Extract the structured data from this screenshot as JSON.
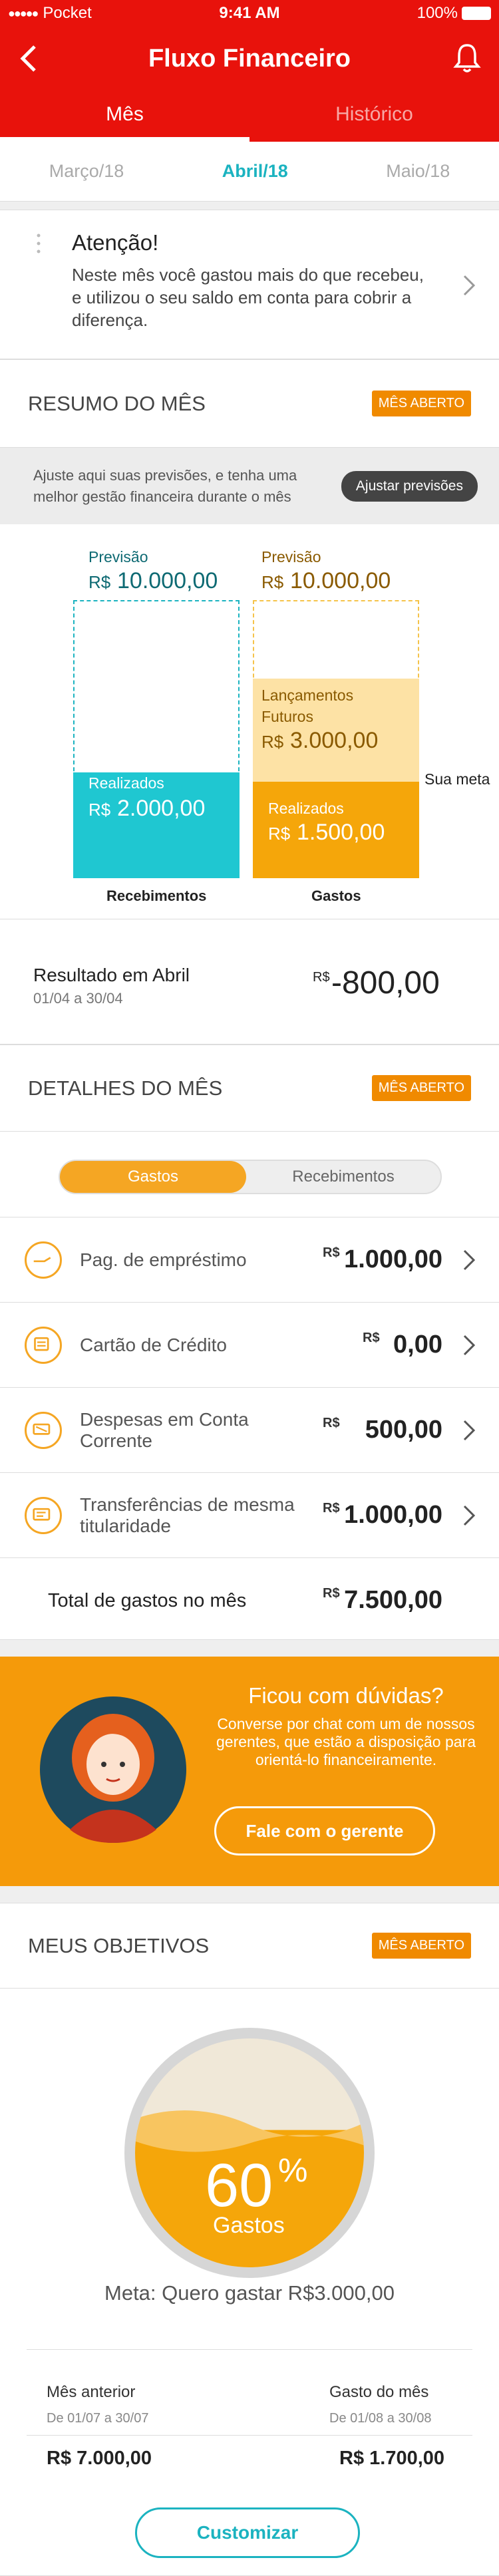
{
  "status_bar": {
    "carrier": "Pocket",
    "time": "9:41 AM",
    "battery": "100%"
  },
  "header": {
    "title": "Fluxo Financeiro"
  },
  "tabs": [
    {
      "label": "Mês"
    },
    {
      "label": "Histórico"
    }
  ],
  "months": {
    "prev": "Março/18",
    "current": "Abril/18",
    "next": "Maio/18"
  },
  "alert": {
    "title": "Atenção!",
    "text": "Neste mês você gastou mais do que recebeu, e utilizou o seu saldo em conta para cobrir a diferença."
  },
  "resumo": {
    "title": "RESUMO DO MÊS",
    "badge": "MÊS ABERTO",
    "adjust_text": "Ajuste aqui suas previsões, e tenha uma melhor gestão financeira durante o mês",
    "adjust_button": "Ajustar previsões",
    "receb": {
      "prev_label": "Previsão",
      "prev_cur": "R$",
      "prev_value": "10.000,00",
      "real_label": "Realizados",
      "real_cur": "R$",
      "real_value": "2.000,00",
      "caption": "Recebimentos",
      "fill": 0.2
    },
    "gastos": {
      "prev_label": "Previsão",
      "prev_cur": "R$",
      "prev_value": "10.000,00",
      "lanc_label": "Lançamentos",
      "lanc_label2": "Futuros",
      "lanc_cur": "R$",
      "lanc_value": "3.000,00",
      "real_label": "Realizados",
      "real_cur": "R$",
      "real_value": "1.500,00",
      "caption": "Gastos",
      "meta": "Sua meta"
    },
    "result_label": "Resultado em Abril",
    "result_period": "01/04 a 30/04",
    "result_cur": "R$",
    "result_value": "-800,00"
  },
  "details": {
    "title": "DETALHES DO MÊS",
    "badge": "MÊS ABERTO",
    "toggle_on": "Gastos",
    "toggle_off": "Recebimentos",
    "rows": [
      {
        "name": "Pag. de empréstimo",
        "cur": "R$",
        "value": "1.000,00"
      },
      {
        "name": "Cartão de Crédito",
        "cur": "R$",
        "value": "0,00"
      },
      {
        "name": "Despesas em Conta Corrente",
        "cur": "R$",
        "value": "500,00"
      },
      {
        "name": "Transferências de mesma titularidade",
        "cur": "R$",
        "value": "1.000,00"
      }
    ],
    "total_label": "Total de gastos no mês",
    "total_cur": "R$",
    "total_value": "7.500,00"
  },
  "chat": {
    "title": "Ficou com dúvidas?",
    "text": "Converse por chat com um de nossos gerentes, que estão a disposição para orientá-lo financeiramente.",
    "button": "Fale com o gerente"
  },
  "goals": {
    "title": "MEUS OBJETIVOS",
    "badge": "MÊS ABERTO",
    "percent": "60",
    "percent_sign": "%",
    "gauge_label": "Gastos",
    "fill": 0.6,
    "meta_text": "Meta: Quero gastar R$3.000,00",
    "prev_label": "Mês anterior",
    "prev_period": "De 01/07 a 30/07",
    "prev_value": "R$ 7.000,00",
    "cur_label": "Gasto do mês",
    "cur_period": "De 01/08 a 30/08",
    "cur_value": "R$ 1.700,00",
    "button": "Customizar"
  },
  "colors": {
    "brand": "#e8120c",
    "accent": "#f5a623",
    "teal": "#1bb3c0"
  }
}
